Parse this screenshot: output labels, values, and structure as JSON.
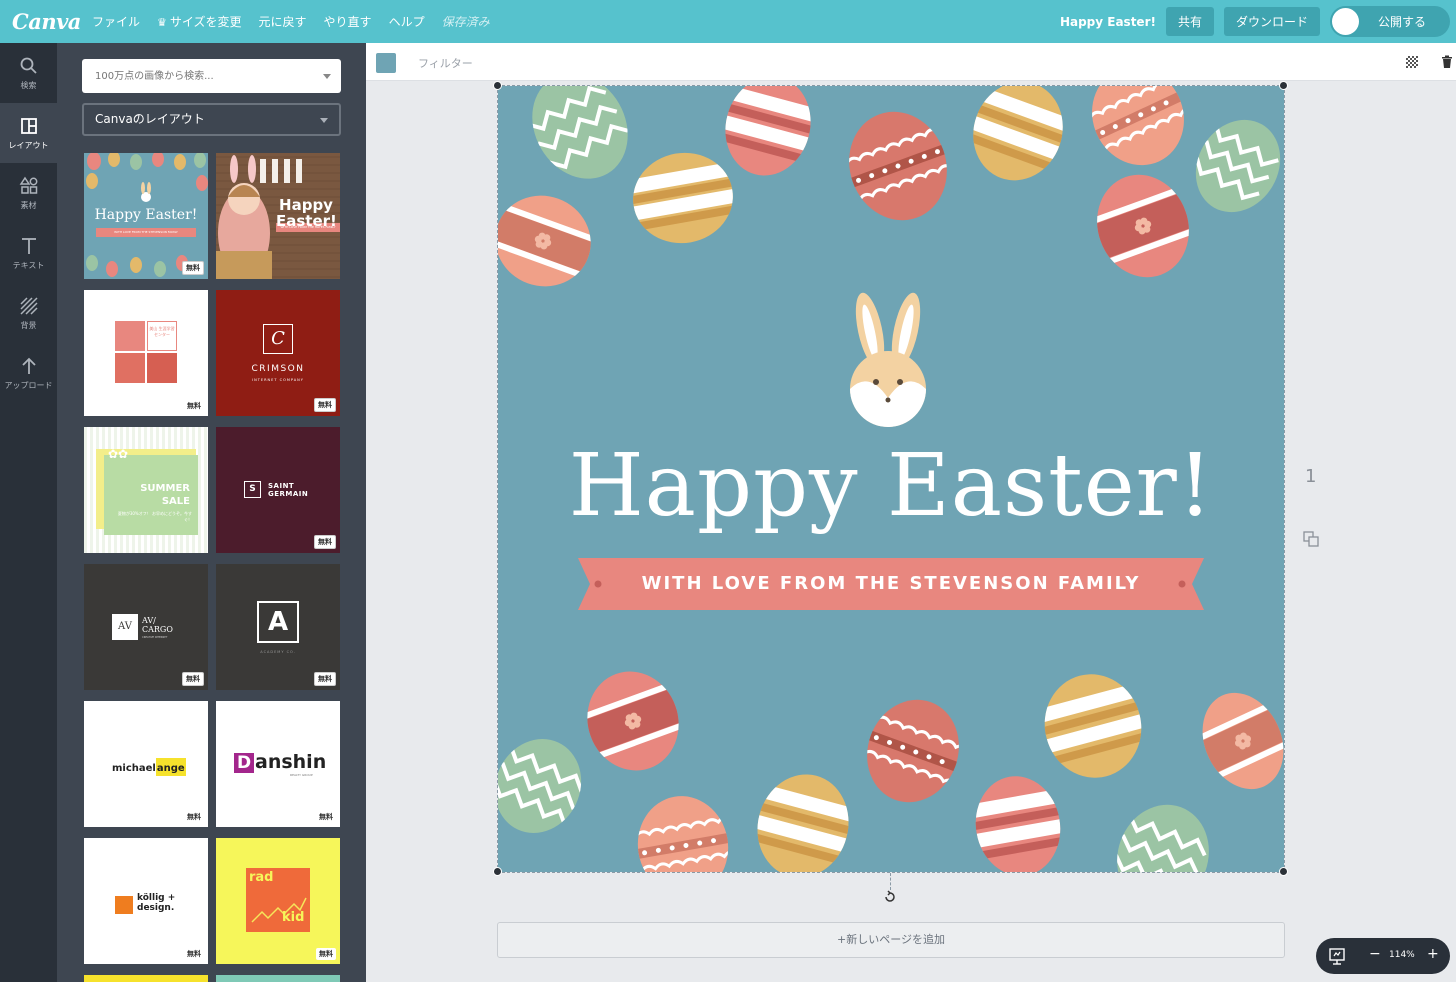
{
  "topbar": {
    "logo": "Canva",
    "menu": [
      "ファイル",
      "サイズを変更",
      "元に戻す",
      "やり直す",
      "ヘルプ"
    ],
    "save_status": "保存済み",
    "doc_title": "Happy Easter!",
    "share": "共有",
    "download": "ダウンロード",
    "publish": "公開する"
  },
  "rail": [
    {
      "label": "検索",
      "icon": "search-icon"
    },
    {
      "label": "レイアウト",
      "icon": "layout-icon"
    },
    {
      "label": "素材",
      "icon": "elements-icon"
    },
    {
      "label": "テキスト",
      "icon": "text-icon"
    },
    {
      "label": "背景",
      "icon": "background-icon"
    },
    {
      "label": "アップロード",
      "icon": "upload-icon"
    }
  ],
  "panel": {
    "search_placeholder": "100万点の画像から検索...",
    "layout_select": "Canvaのレイアウト",
    "badge": "無料",
    "thumbs": [
      {
        "title": "Happy Easter!",
        "sub": "WITH LOVE FROM THE STEVENSON FAMILY"
      },
      {
        "title": "Happy Easter!",
        "sub": "WITH LOVE FROM THE HAYES FAMILY"
      },
      {
        "title": "美山 生涯学習 センター"
      },
      {
        "title": "CRIMSON",
        "sub": "INTERNET COMPANY"
      },
      {
        "title": "SUMMER SALE",
        "sub": "夏物が30%オフ！ お早めにどうぞ。今すぐ！"
      },
      {
        "title": "SAINT GERMAIN",
        "mark": "S"
      },
      {
        "title": "AV/ CARGO",
        "mark": "AV",
        "sub": "CREATIVE INTERNET"
      },
      {
        "title": "ACADEMY CO.",
        "mark": "A"
      },
      {
        "title": "michael",
        "accent": "ange"
      },
      {
        "title": "anshin",
        "mark": "D",
        "sub": "REALTY GROUP"
      },
      {
        "title": "köllig + design."
      },
      {
        "title": "rad",
        "sub": "kid"
      }
    ]
  },
  "canvas": {
    "filter": "フィルター",
    "headline": "Happy Easter!",
    "ribbon": "WITH LOVE FROM THE STEVENSON FAMILY",
    "page_number": "1",
    "add_page": "+新しいページを追加",
    "zoom": "114%",
    "zoom_minus": "−",
    "zoom_plus": "+",
    "colors": {
      "background": "#6fa4b4",
      "ribbon": "#e8877f"
    }
  }
}
